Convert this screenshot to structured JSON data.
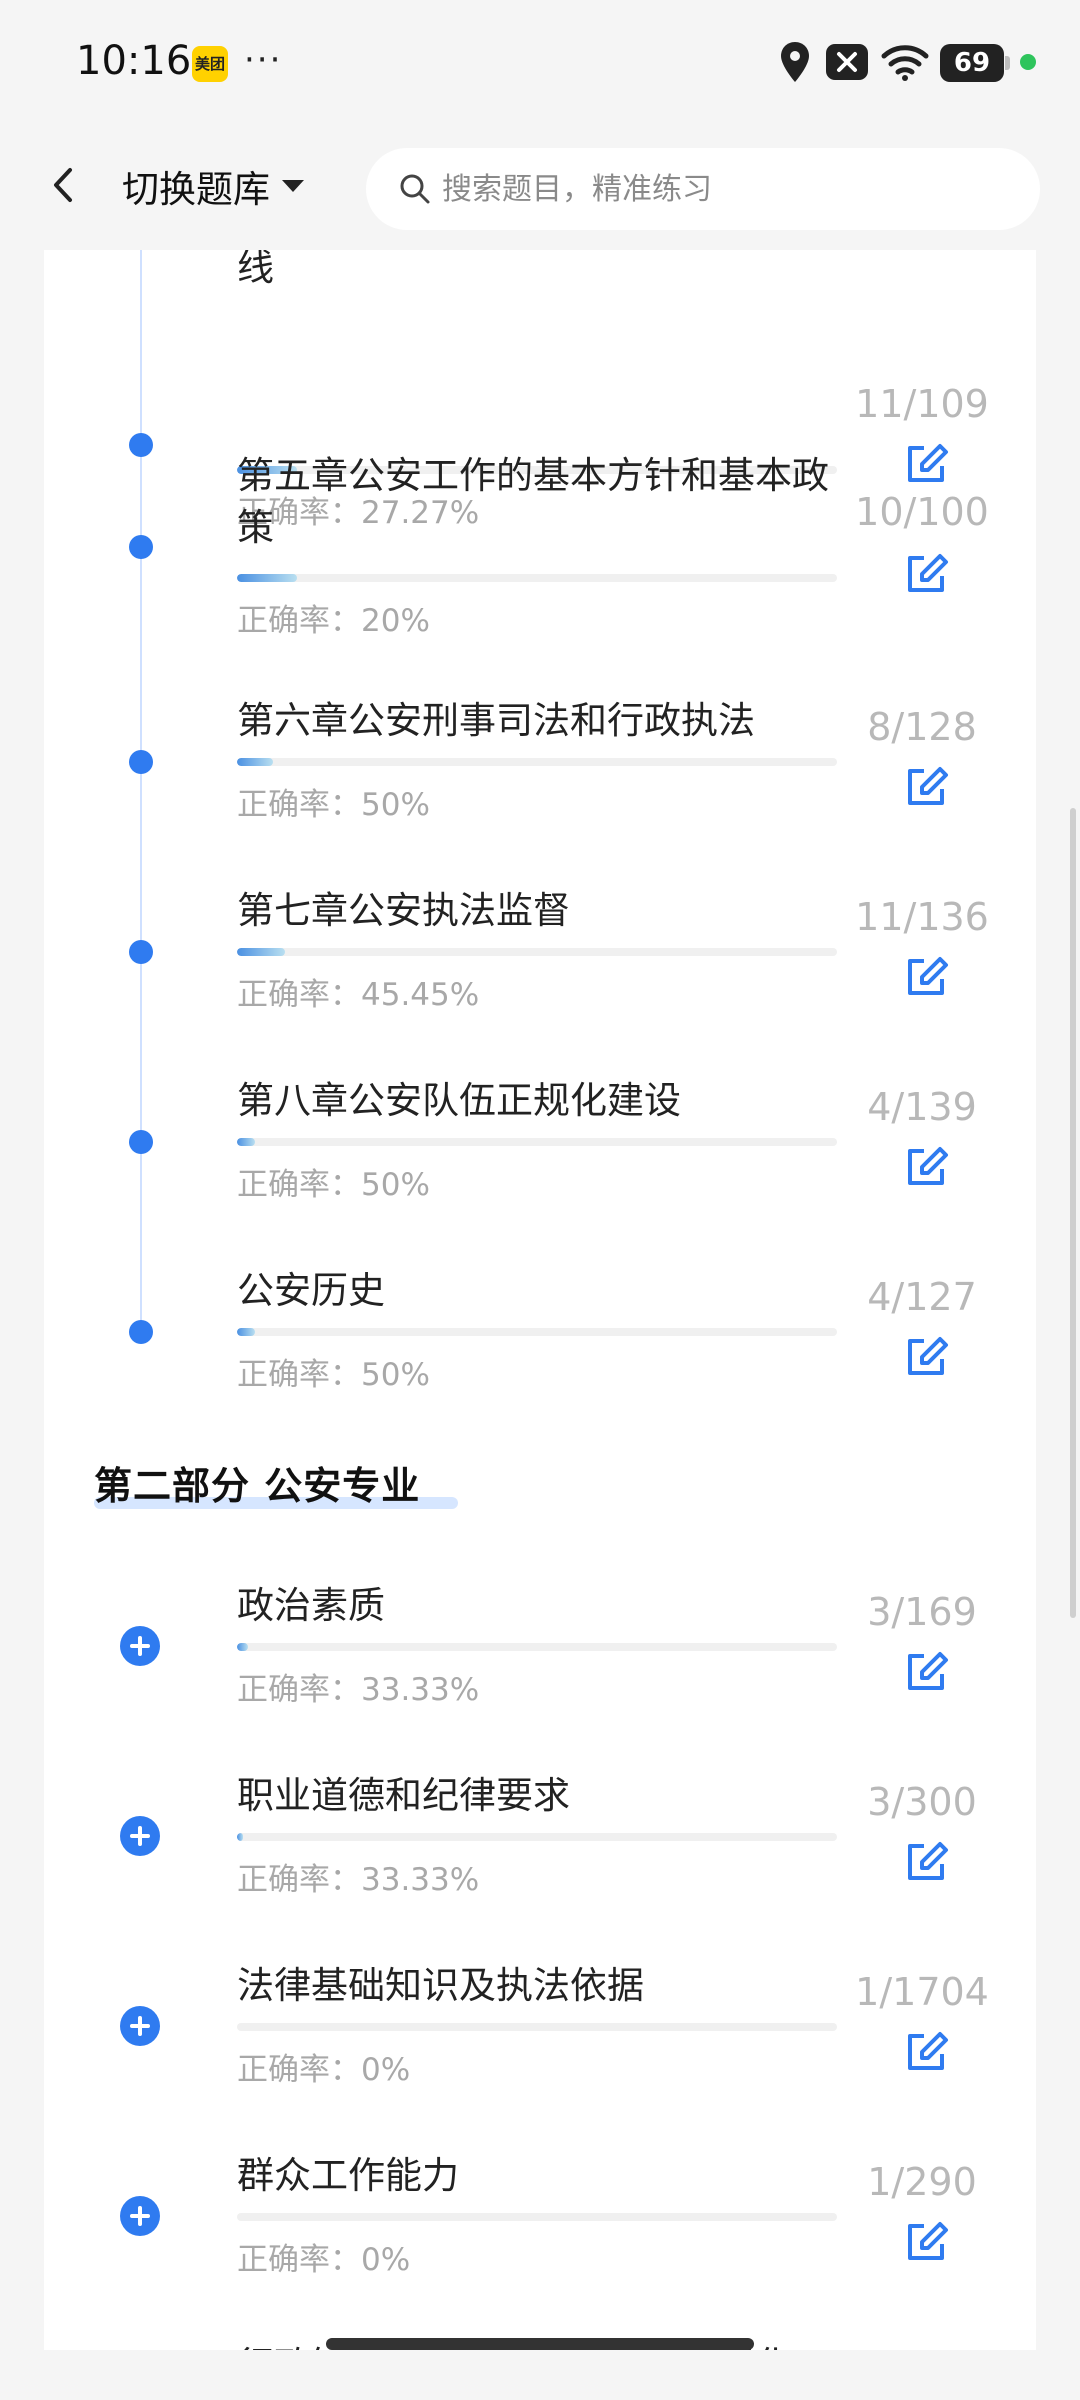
{
  "status": {
    "time": "10:16",
    "app_badge": "美团",
    "more": "···",
    "battery": "69"
  },
  "nav": {
    "switch_label": "切换题库",
    "search_placeholder": "搜索题目，精准练习"
  },
  "part1": {
    "items": [
      {
        "title": "第四章公安工作的根本原则和根本路线",
        "count": "11/109",
        "rate_label": "正确率：",
        "rate": "27.27%",
        "progress": 0.1
      },
      {
        "title": "第五章公安工作的基本方针和基本政策",
        "count": "10/100",
        "rate_label": "正确率：",
        "rate": "20%",
        "progress": 0.1
      },
      {
        "title": "第六章公安刑事司法和行政执法",
        "count": "8/128",
        "rate_label": "正确率：",
        "rate": "50%",
        "progress": 0.06
      },
      {
        "title": "第七章公安执法监督",
        "count": "11/136",
        "rate_label": "正确率：",
        "rate": "45.45%",
        "progress": 0.08
      },
      {
        "title": "第八章公安队伍正规化建设",
        "count": "4/139",
        "rate_label": "正确率：",
        "rate": "50%",
        "progress": 0.03
      },
      {
        "title": "公安历史",
        "count": "4/127",
        "rate_label": "正确率：",
        "rate": "50%",
        "progress": 0.03
      }
    ]
  },
  "part2": {
    "section_title": "第二部分 公安专业",
    "items": [
      {
        "title": "政治素质",
        "count": "3/169",
        "rate_label": "正确率：",
        "rate": "33.33%",
        "progress": 0.018
      },
      {
        "title": "职业道德和纪律要求",
        "count": "3/300",
        "rate_label": "正确率：",
        "rate": "33.33%",
        "progress": 0.01
      },
      {
        "title": "法律基础知识及执法依据",
        "count": "1/1704",
        "rate_label": "正确率：",
        "rate": "0%",
        "progress": 0.0
      },
      {
        "title": "群众工作能力",
        "count": "1/290",
        "rate_label": "正确率：",
        "rate": "0%",
        "progress": 0.0
      },
      {
        "title": "行政管理能力（调查研究、组织化",
        "count": "",
        "rate_label": "",
        "rate": "",
        "progress": 0.0
      }
    ]
  },
  "colors": {
    "accent": "#2f7bf0",
    "muted_text": "#a8a8a8"
  }
}
